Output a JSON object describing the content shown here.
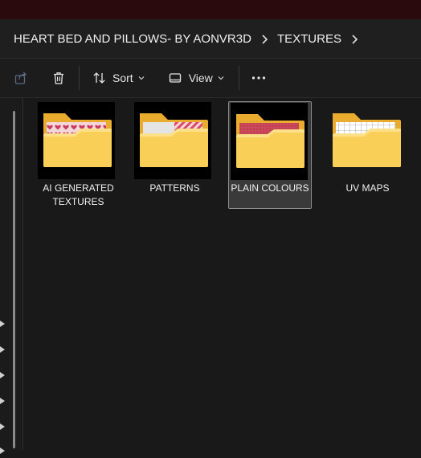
{
  "addressbar": {
    "crumbs": [
      "HEART BED AND PILLOWS- BY AONVR3D",
      "TEXTURES"
    ]
  },
  "toolbar": {
    "share_icon": "share-icon",
    "delete_icon": "trash-icon",
    "sort_label": "Sort",
    "view_label": "View",
    "more_icon": "ellipsis-icon"
  },
  "folders": [
    {
      "name": "AI GENERATED TEXTURES",
      "selected": false,
      "preview": "heart-pattern"
    },
    {
      "name": "PATTERNS",
      "selected": false,
      "preview": "stripe-pattern"
    },
    {
      "name": "PLAIN COLOURS",
      "selected": true,
      "preview": "plain-red"
    },
    {
      "name": "UV MAPS",
      "selected": false,
      "preview": "uv-grid"
    }
  ],
  "colors": {
    "window_bg": "#191919",
    "folder_yellow": "#f7c948",
    "title_bar": "#2a0a0c",
    "selection": "#3a3a3a"
  }
}
